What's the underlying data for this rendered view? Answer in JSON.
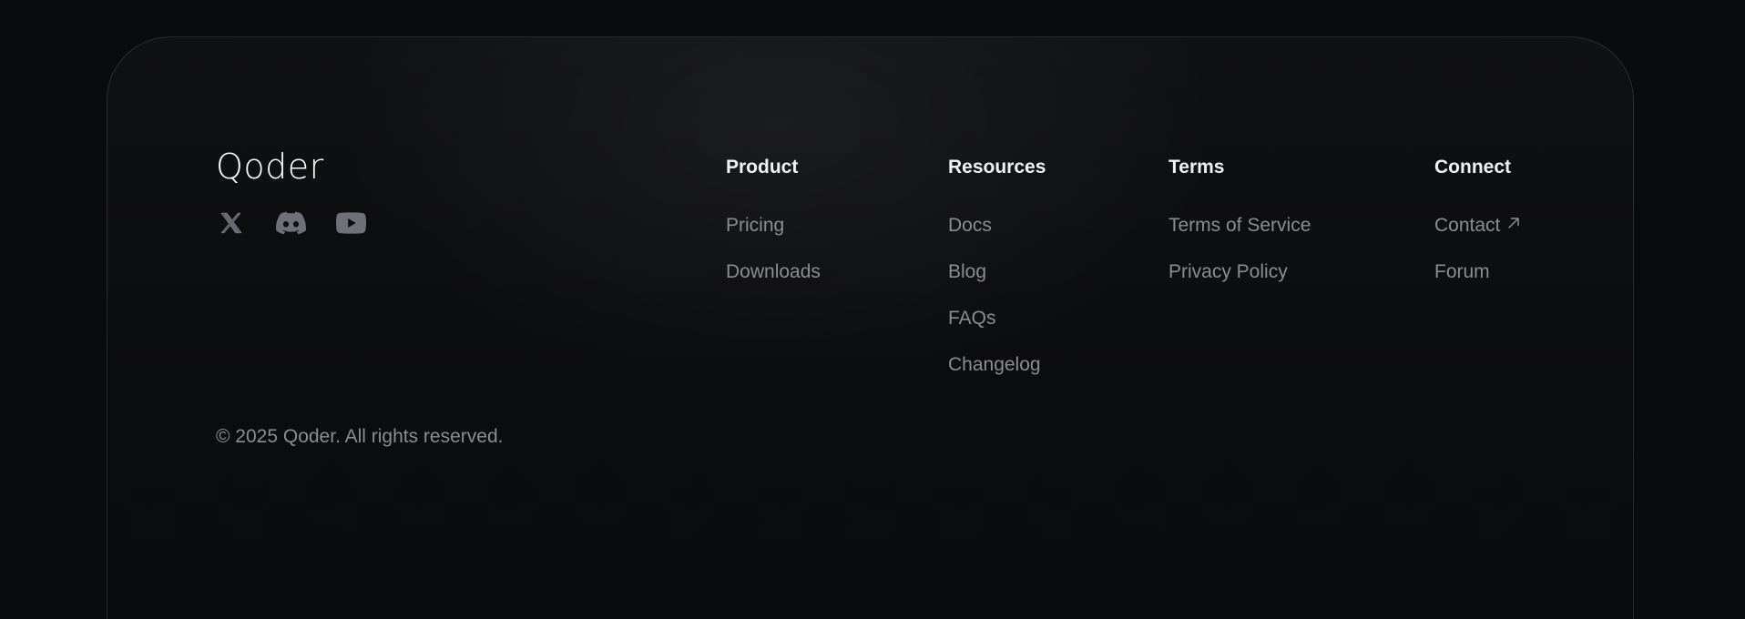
{
  "brand": {
    "logo_text": "Qoder",
    "social": [
      {
        "icon": "x-icon",
        "name": "X"
      },
      {
        "icon": "discord-icon",
        "name": "Discord"
      },
      {
        "icon": "youtube-icon",
        "name": "YouTube"
      }
    ]
  },
  "columns": {
    "product": {
      "title": "Product",
      "links": [
        "Pricing",
        "Downloads"
      ]
    },
    "resources": {
      "title": "Resources",
      "links": [
        "Docs",
        "Blog",
        "FAQs",
        "Changelog"
      ]
    },
    "terms": {
      "title": "Terms",
      "links": [
        "Terms of Service",
        "Privacy Policy"
      ]
    },
    "connect": {
      "title": "Connect",
      "links": [
        "Contact",
        "Forum"
      ],
      "external_icon": "arrow-up-right-icon"
    }
  },
  "copyright": "© 2025 Qoder. All rights reserved.",
  "colors": {
    "background": "#0a0b0d",
    "heading": "#f2f2f2",
    "link": "#8b8d91",
    "icon": "#6f7176"
  }
}
